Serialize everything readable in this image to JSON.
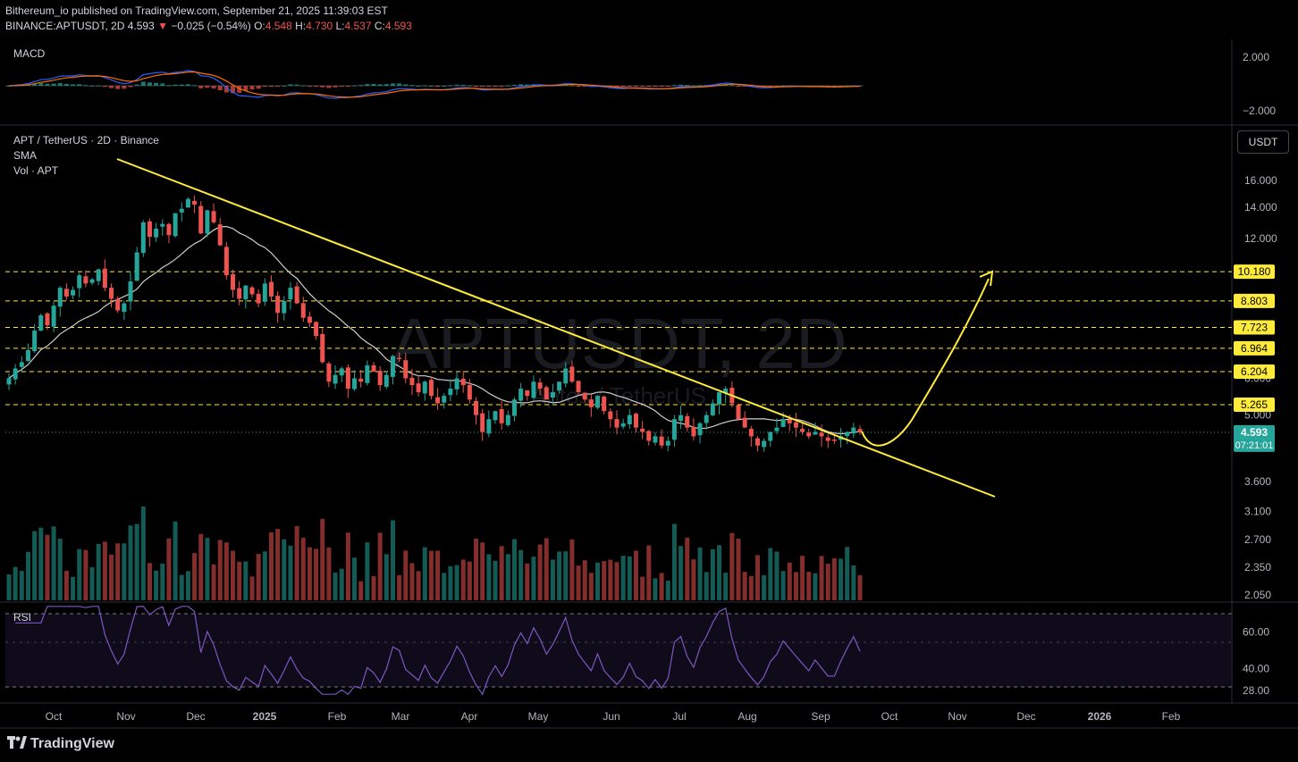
{
  "header": {
    "line1": "Bithereum_io published on TradingView.com, September 21, 2025 11:39:03 EST",
    "symbol": "BINANCE:APTUSDT, 2D",
    "price": "4.593",
    "arrow": "▼",
    "change": "−0.025 (−0.54%)",
    "o_label": "O:",
    "o": "4.548",
    "h_label": "H:",
    "h": "4.730",
    "l_label": "L:",
    "l": "4.537",
    "c_label": "C:",
    "c": "4.593"
  },
  "panes": {
    "macd_label": "MACD",
    "main_title": "APT / TetherUS · 2D · Binance",
    "sma_label": "SMA",
    "vol_label": "Vol · APT",
    "rsi_label": "RSI",
    "watermark_1": "APTUSDT, 2D",
    "watermark_2": "Aptos / TetherUS"
  },
  "currency_button": "USDT",
  "footer": {
    "brand": "TradingView"
  },
  "colors": {
    "up": "#26a69a",
    "down": "#ef5350",
    "trendline": "#ffeb3b",
    "sma": "#cfcfcf",
    "rsi": "#7e57c2",
    "macd": "#2962ff",
    "signal": "#ff6d00",
    "label_bg": "#ffeb3b",
    "current_bg": "#26a69a"
  },
  "chart_data": {
    "type": "candlestick",
    "title": "APT / TetherUS · 2D · Binance",
    "x_axis": [
      "Oct",
      "Nov",
      "Dec",
      "2025",
      "Feb",
      "Mar",
      "Apr",
      "May",
      "Jun",
      "Jul",
      "Aug",
      "Sep",
      "Oct",
      "Nov",
      "Dec",
      "2026",
      "Feb"
    ],
    "y_axis_ticks": [
      "16.000",
      "14.000",
      "12.000",
      "6.000",
      "5.000",
      "4.300",
      "3.600",
      "3.100",
      "2.700",
      "2.350",
      "2.050"
    ],
    "y_scale": "log",
    "levels": [
      "10.180",
      "8.803",
      "7.723",
      "6.964",
      "6.204",
      "5.265"
    ],
    "current_price": "4.593",
    "countdown": "07:21:01",
    "macd_ticks": [
      "2.000",
      "−2.000"
    ],
    "rsi_ticks": [
      "60.00",
      "40.00",
      "28.00"
    ],
    "closes": [
      6.0,
      6.3,
      6.5,
      6.9,
      7.6,
      8.2,
      7.8,
      8.6,
      9.4,
      9.0,
      9.3,
      10.0,
      9.6,
      9.8,
      10.3,
      9.4,
      8.9,
      8.4,
      8.7,
      9.7,
      11.2,
      13.0,
      12.1,
      12.6,
      12.9,
      12.2,
      13.6,
      13.9,
      14.6,
      14.2,
      12.3,
      13.8,
      13.0,
      11.6,
      10.0,
      9.3,
      8.9,
      9.5,
      9.1,
      8.7,
      9.6,
      9.0,
      8.3,
      8.8,
      9.4,
      8.7,
      8.1,
      7.9,
      7.4,
      6.5,
      5.9,
      6.1,
      6.3,
      5.7,
      6.0,
      5.9,
      6.4,
      6.2,
      5.8,
      6.1,
      6.7,
      6.6,
      6.0,
      5.8,
      5.6,
      5.9,
      5.5,
      5.3,
      5.5,
      5.7,
      6.0,
      5.8,
      5.4,
      5.0,
      4.6,
      4.9,
      5.1,
      4.8,
      5.0,
      5.4,
      5.7,
      5.5,
      5.9,
      5.7,
      5.4,
      5.6,
      5.9,
      6.3,
      5.9,
      5.6,
      5.4,
      5.2,
      5.5,
      5.1,
      4.9,
      4.7,
      4.8,
      5.0,
      4.7,
      4.6,
      4.4,
      4.5,
      4.3,
      4.4,
      4.9,
      5.0,
      4.7,
      4.5,
      4.8,
      5.0,
      5.3,
      5.6,
      5.7,
      5.3,
      4.9,
      4.7,
      4.5,
      4.3,
      4.4,
      4.6,
      4.7,
      4.9,
      4.8,
      4.7,
      4.6,
      4.5,
      4.6,
      4.5,
      4.4,
      4.4,
      4.5,
      4.6,
      4.7,
      4.593
    ],
    "sma_note": "SMA line",
    "volume": "Vol · APT",
    "rsi_levels": [
      70,
      30
    ]
  }
}
